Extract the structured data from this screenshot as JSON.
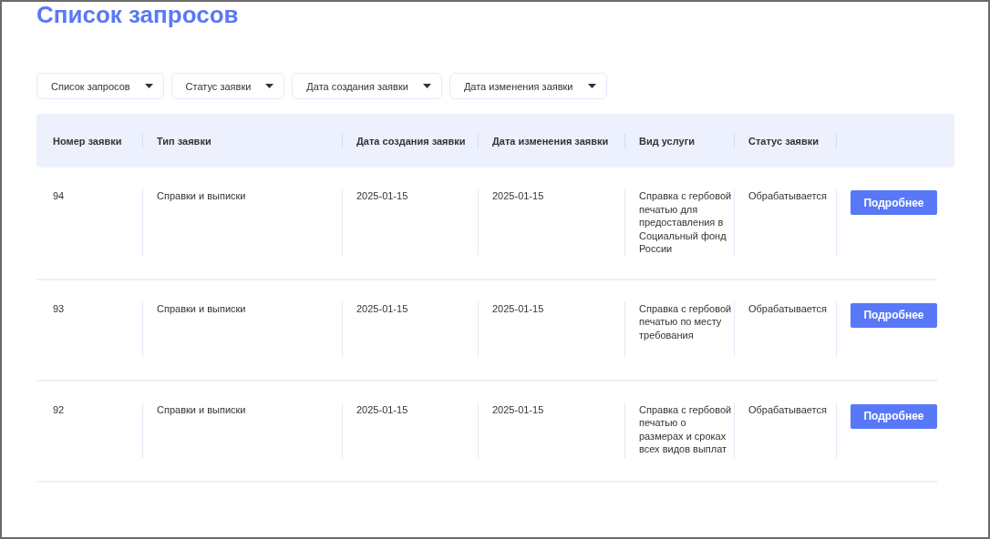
{
  "title": "Список запросов",
  "filters": [
    {
      "label": "Список запросов"
    },
    {
      "label": "Статус заявки"
    },
    {
      "label": "Дата создания заявки"
    },
    {
      "label": "Дата изменения заявки"
    }
  ],
  "table": {
    "columns": [
      "Номер заявки",
      "Тип заявки",
      "Дата создания заявки",
      "Дата изменения заявки",
      "Вид услуги",
      "Статус заявки"
    ],
    "rows": [
      {
        "number": "94",
        "type": "Справки и выписки",
        "created": "2025-01-15",
        "modified": "2025-01-15",
        "service": "Справка с гербовой печатью для предоставления в Социальный фонд России",
        "status": "Обрабатывается",
        "action": "Подробнее"
      },
      {
        "number": "93",
        "type": "Справки и выписки",
        "created": "2025-01-15",
        "modified": "2025-01-15",
        "service": "Справка с гербовой печатью по месту требования",
        "status": "Обрабатывается",
        "action": "Подробнее"
      },
      {
        "number": "92",
        "type": "Справки и выписки",
        "created": "2025-01-15",
        "modified": "2025-01-15",
        "service": "Справка с гербовой печатью о размерах и сроках всех видов выплат",
        "status": "Обрабатывается",
        "action": "Подробнее"
      }
    ]
  }
}
